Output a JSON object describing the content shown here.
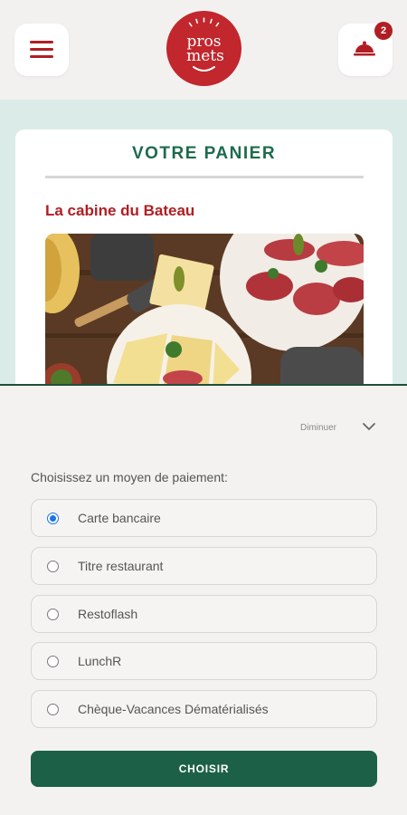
{
  "header": {
    "logo_line1": "pros",
    "logo_line2": "mets",
    "cart_count": "2"
  },
  "card": {
    "title": "VOTRE PANIER",
    "restaurant": "La cabine du Bateau"
  },
  "sheet": {
    "collapse_label": "Diminuer",
    "payment_heading": "Choisissez un moyen de paiement:",
    "options": [
      {
        "label": "Carte bancaire",
        "selected": true
      },
      {
        "label": "Titre restaurant",
        "selected": false
      },
      {
        "label": "Restoflash",
        "selected": false
      },
      {
        "label": "LunchR",
        "selected": false
      },
      {
        "label": "Chèque-Vacances Dématérialisés",
        "selected": false
      }
    ],
    "choose_label": "CHOISIR"
  },
  "colors": {
    "brand_red": "#b01e23",
    "brand_green": "#1d6048",
    "teal_band": "#dbece8"
  }
}
